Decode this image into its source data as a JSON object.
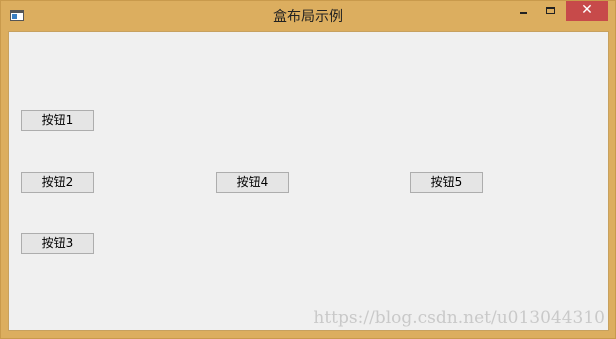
{
  "window": {
    "title": "盒布局示例",
    "close_glyph": "✕"
  },
  "buttons": [
    {
      "label": "按钮1"
    },
    {
      "label": "按钮2"
    },
    {
      "label": "按钮3"
    },
    {
      "label": "按钮4"
    },
    {
      "label": "按钮5"
    }
  ],
  "watermark": "https://blog.csdn.net/u013044310",
  "colors": {
    "frame": "#dcae5f",
    "client_bg": "#f0f0f0",
    "close_button": "#c74a4a",
    "button_bg": "#e5e5e5"
  }
}
